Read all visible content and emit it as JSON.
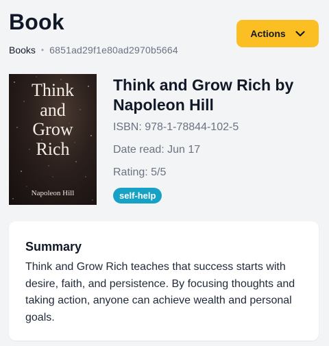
{
  "header": {
    "title": "Book",
    "breadcrumb": {
      "parent": "Books",
      "separator": "•",
      "current_id": "6851ad29f1e80ad2970b5664"
    },
    "actions_label": "Actions",
    "actions_icon": "chevron-down-icon",
    "accent_color": "#fbbf24"
  },
  "book": {
    "cover": {
      "title_lines": [
        "Think",
        "and",
        "Grow",
        "Rich"
      ],
      "author": "Napoleon Hill"
    },
    "title": "Think and Grow Rich by Napoleon Hill",
    "isbn": "ISBN: 978-1-78844-102-5",
    "date_read": "Date read: Jun 17",
    "rating": "Rating: 5/5",
    "tag": "self-help",
    "tag_color": "#17a2c5"
  },
  "summary": {
    "heading": "Summary",
    "text": "Think and Grow Rich teaches that success starts with desire, faith, and persistence. By focusing thoughts and taking action, anyone can achieve wealth and personal goals."
  }
}
